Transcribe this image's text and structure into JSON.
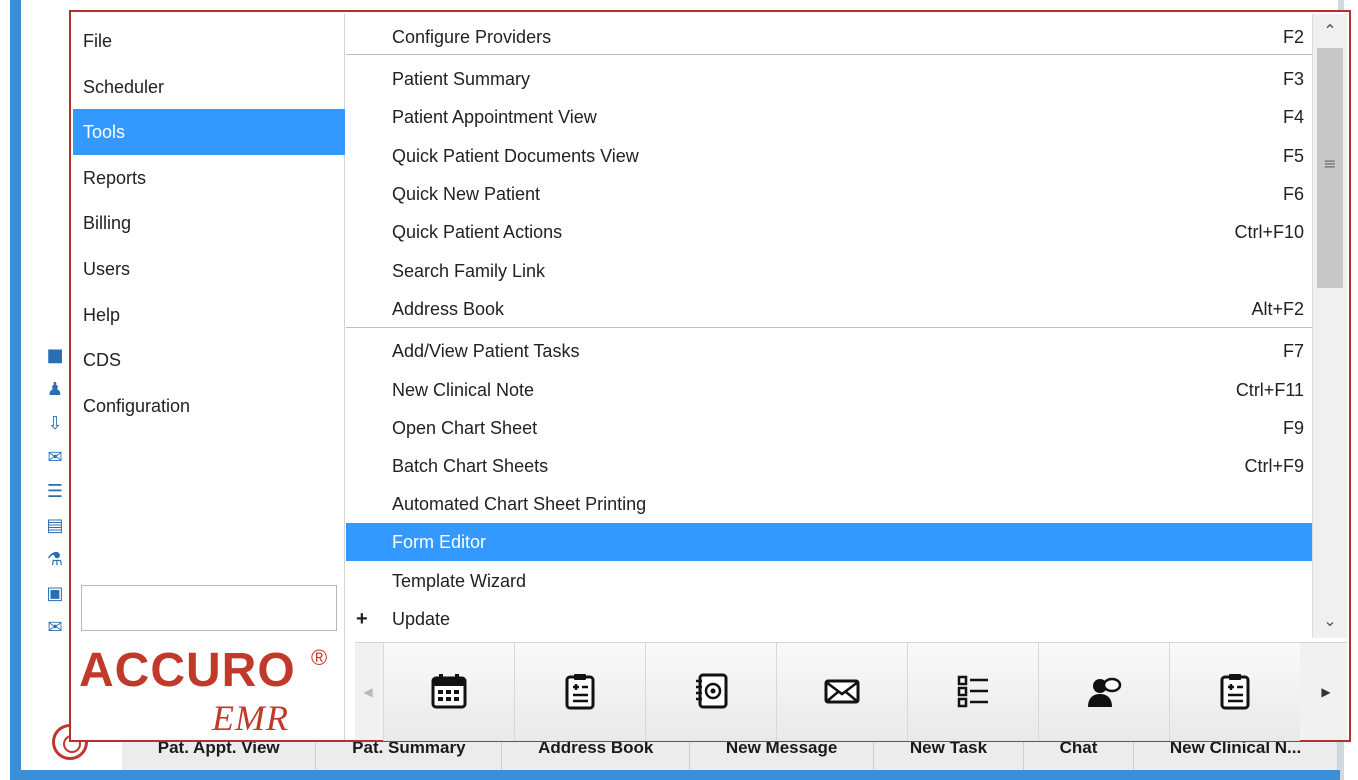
{
  "menu": {
    "categories": [
      {
        "label": "File"
      },
      {
        "label": "Scheduler"
      },
      {
        "label": "Tools",
        "selected": true
      },
      {
        "label": "Reports"
      },
      {
        "label": "Billing"
      },
      {
        "label": "Users"
      },
      {
        "label": "Help"
      },
      {
        "label": "CDS"
      },
      {
        "label": "Configuration"
      }
    ],
    "search": {
      "value": "",
      "placeholder": ""
    },
    "items": [
      {
        "label": "Configure Providers",
        "shortcut": "F2"
      },
      {
        "label": "Patient Summary",
        "shortcut": "F3"
      },
      {
        "label": "Patient Appointment View",
        "shortcut": "F4"
      },
      {
        "label": "Quick Patient Documents View",
        "shortcut": "F5"
      },
      {
        "label": "Quick New Patient",
        "shortcut": "F6"
      },
      {
        "label": "Quick Patient Actions",
        "shortcut": "Ctrl+F10"
      },
      {
        "label": "Search Family Link",
        "shortcut": ""
      },
      {
        "label": "Address Book",
        "shortcut": "Alt+F2"
      },
      {
        "label": "Add/View Patient Tasks",
        "shortcut": "F7"
      },
      {
        "label": "New Clinical Note",
        "shortcut": "Ctrl+F11"
      },
      {
        "label": "Open Chart Sheet",
        "shortcut": "F9"
      },
      {
        "label": "Batch Chart Sheets",
        "shortcut": "Ctrl+F9"
      },
      {
        "label": "Automated Chart Sheet Printing",
        "shortcut": ""
      },
      {
        "label": "Form Editor",
        "shortcut": "",
        "highlighted": true
      },
      {
        "label": "Template Wizard",
        "shortcut": ""
      },
      {
        "label": "Update",
        "shortcut": "",
        "expand": "+"
      }
    ]
  },
  "logo": {
    "name": "ACCURO",
    "registered": "®",
    "sub": "EMR"
  },
  "toolbar": {
    "icons": [
      "calendar-icon",
      "clipboard-icon",
      "address-book-icon",
      "envelope-icon",
      "task-list-icon",
      "chat-icon",
      "clinical-note-icon"
    ]
  },
  "quick_bar": {
    "buttons": [
      "Pat. Appt. View",
      "Pat. Summary",
      "Address Book",
      "New Message",
      "New Task",
      "Chat",
      "New Clinical N..."
    ]
  },
  "colors": {
    "selection": "#3399ff",
    "brand": "#c0392b",
    "frame": "#b3302b",
    "accent_blue": "#3a8fd8"
  }
}
